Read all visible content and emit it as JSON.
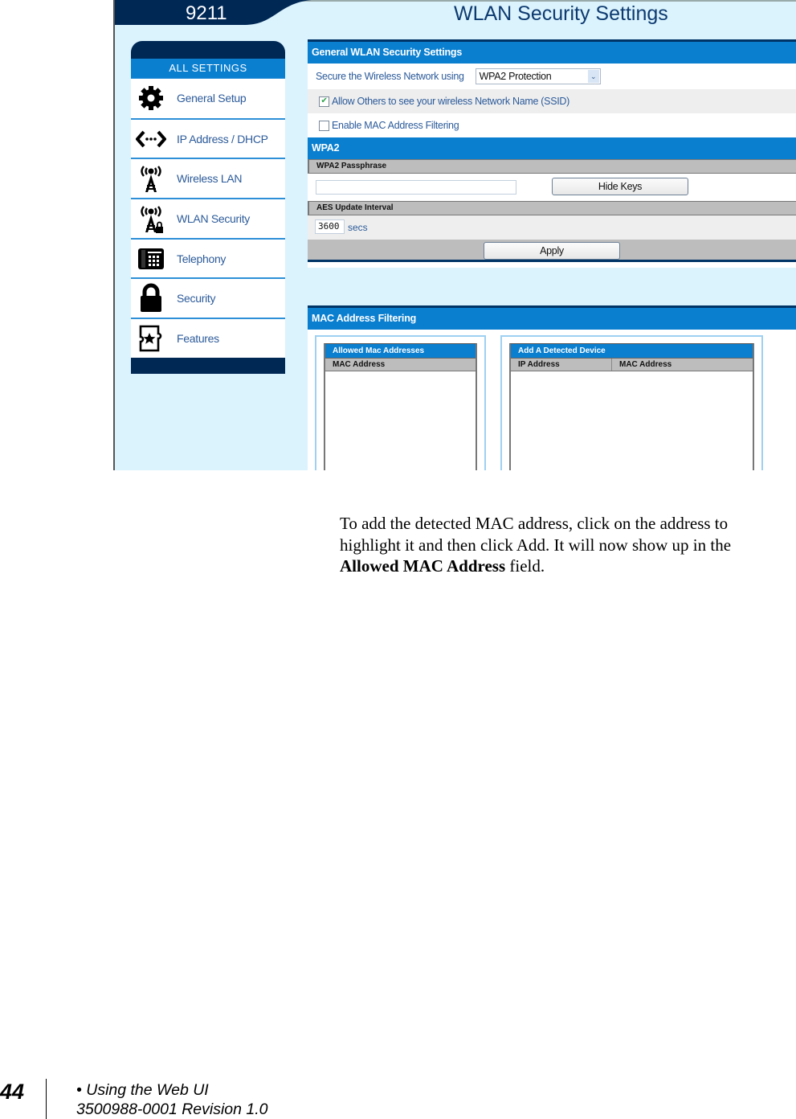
{
  "screenshot": {
    "model": "9211",
    "page_title": "WLAN Security Settings",
    "sidebar": {
      "header": "ALL SETTINGS",
      "items": [
        {
          "label": "General Setup",
          "icon": "gear-icon"
        },
        {
          "label": "IP Address / DHCP",
          "icon": "network-arrows-icon"
        },
        {
          "label": "Wireless LAN",
          "icon": "wireless-tower-icon"
        },
        {
          "label": "WLAN Security",
          "icon": "wireless-lock-icon"
        },
        {
          "label": "Telephony",
          "icon": "desk-phone-icon"
        },
        {
          "label": "Security",
          "icon": "padlock-icon"
        },
        {
          "label": "Features",
          "icon": "puzzle-star-icon"
        }
      ]
    },
    "general": {
      "title": "General WLAN Security Settings",
      "secure_label": "Secure the Wireless Network using",
      "secure_value": "WPA2 Protection",
      "ssid_label": "Allow Others to see your wireless Network Name (SSID)",
      "ssid_checked": true,
      "mac_filter_label": "Enable MAC Address Filtering",
      "mac_filter_checked": false
    },
    "wpa2": {
      "title": "WPA2",
      "passphrase_label": "WPA2 Passphrase",
      "passphrase_value": "",
      "hide_keys_label": "Hide Keys",
      "aes_label": "AES Update Interval",
      "aes_value": "3600",
      "aes_unit": "secs",
      "apply_label": "Apply"
    },
    "mac_filtering": {
      "title": "MAC Address Filtering",
      "allowed": {
        "title": "Allowed Mac Addresses",
        "columns": [
          "MAC Address"
        ],
        "rows": []
      },
      "detected": {
        "title": "Add A Detected Device",
        "columns": [
          "IP Address",
          "MAC Address"
        ],
        "rows": []
      }
    },
    "colors": {
      "banner": "#002855",
      "section_header": "#0a7fd0",
      "page_background": "#dbf3fd",
      "label_text": "#2c5b9a"
    }
  },
  "document": {
    "paragraph_part1": "To add the detected MAC address, click on the address to highlight it and then click Add.  It will now show up in the ",
    "paragraph_bold": "Allowed MAC Address",
    "paragraph_part2": " field."
  },
  "footer": {
    "page_number": "44",
    "section": "• Using the Web UI",
    "doc_id": "3500988-0001  Revision 1.0"
  }
}
